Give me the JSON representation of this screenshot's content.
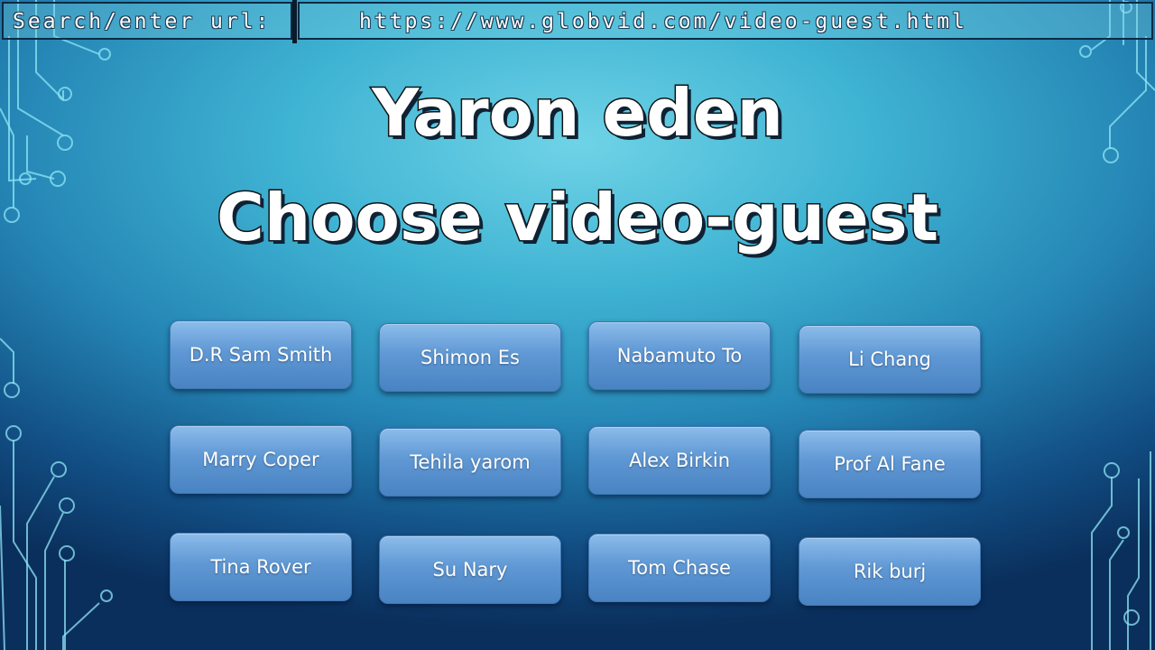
{
  "urlbar": {
    "label": "Search/enter url:",
    "url": "https://www.globvid.com/video-guest.html"
  },
  "header": {
    "line1": "Yaron eden",
    "line2": "Choose video-guest"
  },
  "guests": [
    "D.R Sam Smith",
    "Shimon Es",
    "Nabamuto To",
    "Li Chang",
    "Marry Coper",
    "Tehila yarom",
    "Alex Birkin",
    "Prof Al Fane",
    "Tina Rover",
    "Su Nary",
    "Tom Chase",
    "Rik burj"
  ],
  "colors": {
    "button_top": "#8cbcea",
    "button_bottom": "#4a83c2",
    "background_center": "#6fd3e6",
    "background_edge": "#0a2f5c"
  }
}
